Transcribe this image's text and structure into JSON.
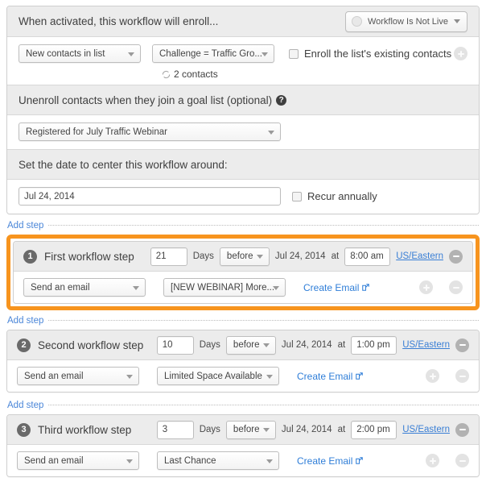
{
  "enrollment": {
    "header_title": "When activated, this workflow will enroll...",
    "live_status": {
      "label": "Workflow Is Not Live",
      "dot_icon": "status-circle-icon",
      "caret_icon": "chevron-down-icon"
    },
    "trigger_type": "New contacts in list",
    "trigger_list": "Challenge = Traffic Gro...",
    "contacts_count": "2 contacts",
    "contacts_icon": "sync-icon",
    "existing_checkbox_label": "Enroll the list's existing contacts",
    "existing_checked": false,
    "add_icon": "plus-circle-icon"
  },
  "unenroll": {
    "header_title": "Unenroll contacts when they join a goal list (optional)",
    "help_icon": "help-icon",
    "help_glyph": "?",
    "goal_list": "Registered for July Traffic Webinar"
  },
  "center_date": {
    "header_title": "Set the date to center this workflow around:",
    "date_value": "Jul 24, 2014",
    "recur_label": "Recur annually",
    "recur_checked": false
  },
  "add_step_label": "Add step",
  "common": {
    "days_label": "Days",
    "at_label": "at",
    "create_email_label": "Create Email",
    "external_icon": "external-link-icon",
    "remove_icon": "minus-circle-icon",
    "add_icon": "plus-circle-icon",
    "timezone": "US/Eastern",
    "action_label": "Send an email"
  },
  "steps": [
    {
      "number": "1",
      "title": "First workflow step",
      "delay_value": "21",
      "days_label": "Days",
      "direction": "before",
      "anchor_date": "Jul 24, 2014",
      "at_label": "at",
      "time": "8:00 am",
      "timezone": "US/Eastern",
      "action": "Send an email",
      "email": "[NEW WEBINAR] More...",
      "create_email_label": "Create Email",
      "highlighted": true
    },
    {
      "number": "2",
      "title": "Second workflow step",
      "delay_value": "10",
      "days_label": "Days",
      "direction": "before",
      "anchor_date": "Jul 24, 2014",
      "at_label": "at",
      "time": "1:00 pm",
      "timezone": "US/Eastern",
      "action": "Send an email",
      "email": "Limited Space Available",
      "create_email_label": "Create Email",
      "highlighted": false
    },
    {
      "number": "3",
      "title": "Third workflow step",
      "delay_value": "3",
      "days_label": "Days",
      "direction": "before",
      "anchor_date": "Jul 24, 2014",
      "at_label": "at",
      "time": "2:00 pm",
      "timezone": "US/Eastern",
      "action": "Send an email",
      "email": "Last Chance",
      "create_email_label": "Create Email",
      "highlighted": false
    }
  ],
  "colors": {
    "highlight": "#f7941e",
    "link": "#2f7ed8",
    "header_bg": "#ececec",
    "border": "#cfcfcf"
  }
}
